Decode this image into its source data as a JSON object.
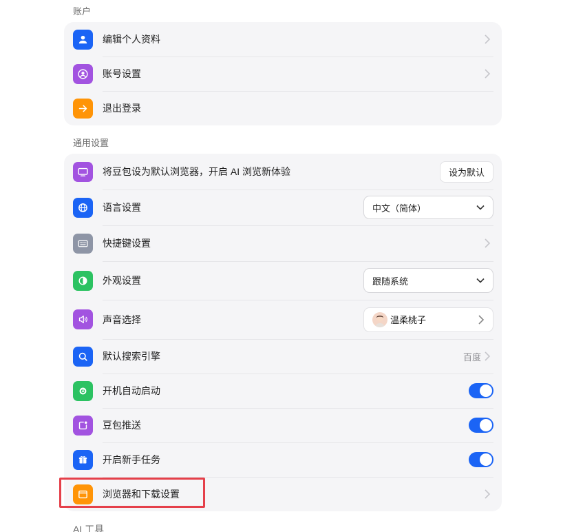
{
  "sections": {
    "account": "账户",
    "general": "通用设置",
    "ai_tools": "AI 工具"
  },
  "account_items": [
    {
      "label": "编辑个人资料",
      "icon": "user-icon"
    },
    {
      "label": "账号设置",
      "icon": "account-circle-icon"
    },
    {
      "label": "退出登录",
      "icon": "arrow-right-icon"
    }
  ],
  "general": {
    "default_browser": {
      "label": "将豆包设为默认浏览器，开启 AI 浏览新体验",
      "button": "设为默认"
    },
    "language": {
      "label": "语言设置",
      "value": "中文（简体）"
    },
    "shortcuts": {
      "label": "快捷键设置"
    },
    "appearance": {
      "label": "外观设置",
      "value": "跟随系统"
    },
    "voice": {
      "label": "声音选择",
      "value": "温柔桃子"
    },
    "search_engine": {
      "label": "默认搜索引擎",
      "value": "百度"
    },
    "autostart": {
      "label": "开机自动启动",
      "on": true
    },
    "push": {
      "label": "豆包推送",
      "on": true
    },
    "tasks": {
      "label": "开启新手任务",
      "on": true
    },
    "browser_download": {
      "label": "浏览器和下载设置"
    }
  },
  "colors": {
    "accent": "#1b64f5",
    "highlight": "#e5404a"
  }
}
